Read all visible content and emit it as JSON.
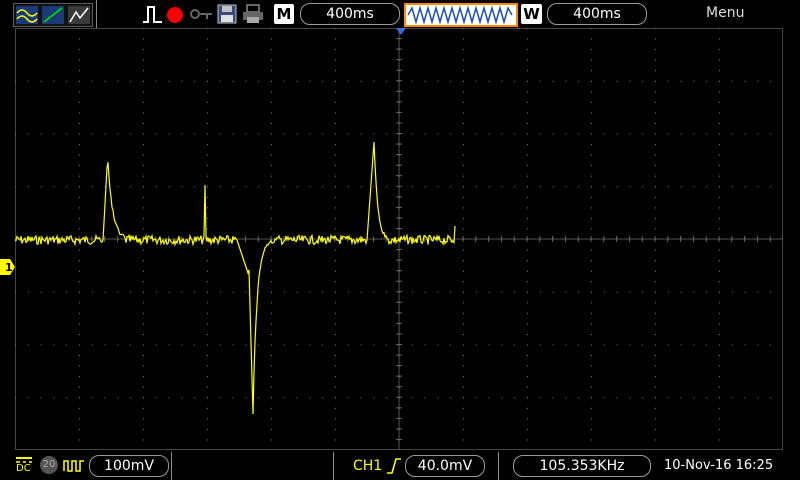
{
  "top": {
    "mode_label": "M",
    "timebase": "400ms",
    "window_label": "W",
    "window_time": "400ms",
    "menu_label": "Menu"
  },
  "bottom": {
    "coupling": "DC",
    "bandwidth_limit": "20",
    "ch1_scale": "100mV",
    "trigger_source": "CH1",
    "trigger_level": "40.0mV",
    "frequency": "105.353KHz",
    "datetime": "10-Nov-16 16:25"
  },
  "channel": {
    "marker": "1",
    "color": "#ffff00"
  },
  "colors": {
    "trace": "#ffff00",
    "grid": "#7a7a7a",
    "accent_orange": "#ff8a00",
    "record_red": "#ff0000",
    "screen_bg": "#000000"
  }
}
